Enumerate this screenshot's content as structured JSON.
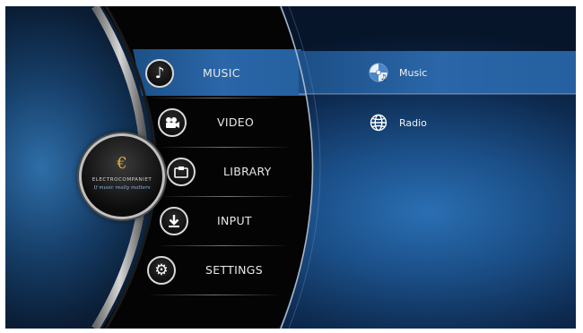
{
  "brand": {
    "logo_letter": "€",
    "name": "ELECTROCOMPANIET",
    "tagline": "If music really matters"
  },
  "menu": {
    "items": [
      {
        "label": "MUSIC",
        "icon": "music-note-icon",
        "selected": true
      },
      {
        "label": "VIDEO",
        "icon": "film-camera-icon",
        "selected": false
      },
      {
        "label": "LIBRARY",
        "icon": "library-folder-icon",
        "selected": false
      },
      {
        "label": "INPUT",
        "icon": "input-download-icon",
        "selected": false
      },
      {
        "label": "SETTINGS",
        "icon": "gear-icon",
        "selected": false
      }
    ]
  },
  "submenu": {
    "items": [
      {
        "label": "Music",
        "icon": "disc-music-icon",
        "selected": true
      },
      {
        "label": "Radio",
        "icon": "globe-icon",
        "selected": false
      }
    ]
  },
  "colors": {
    "highlight": "#2a66a8",
    "background": "#0d2a4f"
  }
}
